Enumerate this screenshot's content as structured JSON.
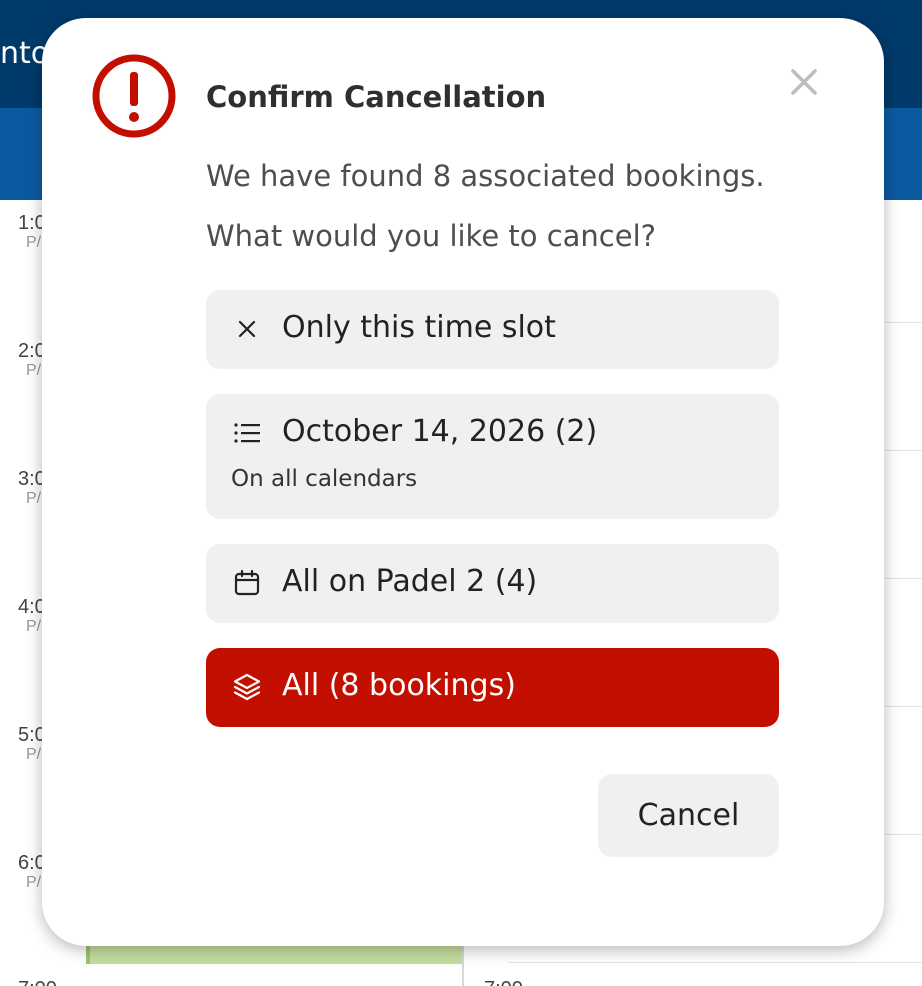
{
  "background": {
    "topbar_title_fragment": "nto",
    "time_slots": [
      {
        "hour": "1:0",
        "ampm": "P/"
      },
      {
        "hour": "2:0",
        "ampm": "P/"
      },
      {
        "hour": "3:0",
        "ampm": "P/"
      },
      {
        "hour": "4:0",
        "ampm": "P/"
      },
      {
        "hour": "5:0",
        "ampm": "P/"
      },
      {
        "hour": "6:0",
        "ampm": "P/"
      }
    ],
    "bottom_labels": [
      "7:00",
      "7:00"
    ]
  },
  "modal": {
    "title": "Confirm Cancellation",
    "message_line1": "We have found 8 associated bookings.",
    "message_line2": "What would you like to cancel?",
    "options": [
      {
        "label": "Only this time slot",
        "icon": "close-x-icon"
      },
      {
        "label": "October 14, 2026 (2)",
        "sublabel": "On all calendars",
        "icon": "list-icon"
      },
      {
        "label": "All on Padel 2 (4)",
        "icon": "calendar-icon"
      },
      {
        "label": "All (8 bookings)",
        "icon": "layers-icon"
      }
    ],
    "cancel_label": "Cancel"
  },
  "colors": {
    "danger": "#c20f00",
    "header": "#003a6b",
    "subheader": "#0b5aa0",
    "option_bg": "#f0f0f0",
    "booking_block": "#c5dea0"
  }
}
